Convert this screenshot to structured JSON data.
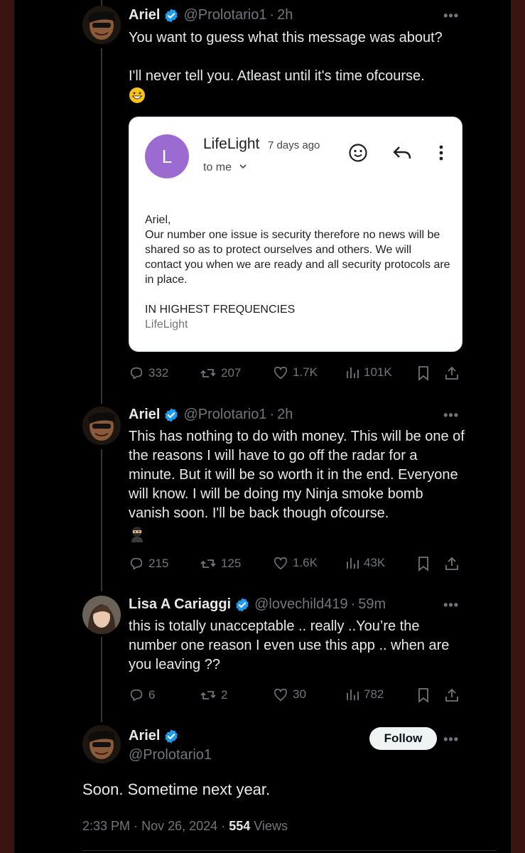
{
  "tweets": [
    {
      "name": "Ariel",
      "handle": "@Prolotario1",
      "sep": "·",
      "time": "2h",
      "more": "•••",
      "text_line1": "You want to guess what this message was about?",
      "text_line2": "I'll never tell you. Atleast until it's time ofcourse.",
      "emoji": "grinning-face-emoji",
      "replies": "332",
      "reposts": "207",
      "likes": "1.7K",
      "views": "101K"
    },
    {
      "name": "Ariel",
      "handle": "@Prolotario1",
      "sep": "·",
      "time": "2h",
      "more": "•••",
      "text": "This has nothing to do with money. This will be one of the reasons I will have to go off the radar for a minute.  But it will be so worth it in the end. Everyone will know. I will be doing my Ninja smoke bomb vanish soon. I'll be back though ofcourse.",
      "emoji": "ninja-emoji",
      "replies": "215",
      "reposts": "125",
      "likes": "1.6K",
      "views": "43K"
    },
    {
      "name": "Lisa A Cariaggi",
      "handle": "@lovechild419",
      "sep": "·",
      "time": "59m",
      "more": "•••",
      "text": "this is totally unacceptable .. really ..You’re the number one reason I even use this app .. when are you leaving ??",
      "replies": "6",
      "reposts": "2",
      "likes": "30",
      "views": "782"
    }
  ],
  "email_card": {
    "avatar_letter": "L",
    "sender": "LifeLight",
    "ago": "7 days ago",
    "to": "to me",
    "greeting": "Ariel,",
    "message": "Our number one issue is security therefore no news will be shared so as to protect ourselves and others. We will contact you when we are ready and all security protocols are in place.",
    "signature": "IN HIGHEST FREQUENCIES",
    "signature_name": "LifeLight"
  },
  "main_tweet": {
    "name": "Ariel",
    "handle": "@Prolotario1",
    "follow_label": "Follow",
    "more": "•••",
    "text": "Soon. Sometime next year.",
    "time": "2:33 PM",
    "date": "Nov 26, 2024",
    "views_count": "554",
    "views_label": "Views",
    "sep": "·"
  },
  "colors": {
    "verified": "#1d9bf0",
    "background": "#000000",
    "border": "#3a1210",
    "muted": "#71767b"
  }
}
